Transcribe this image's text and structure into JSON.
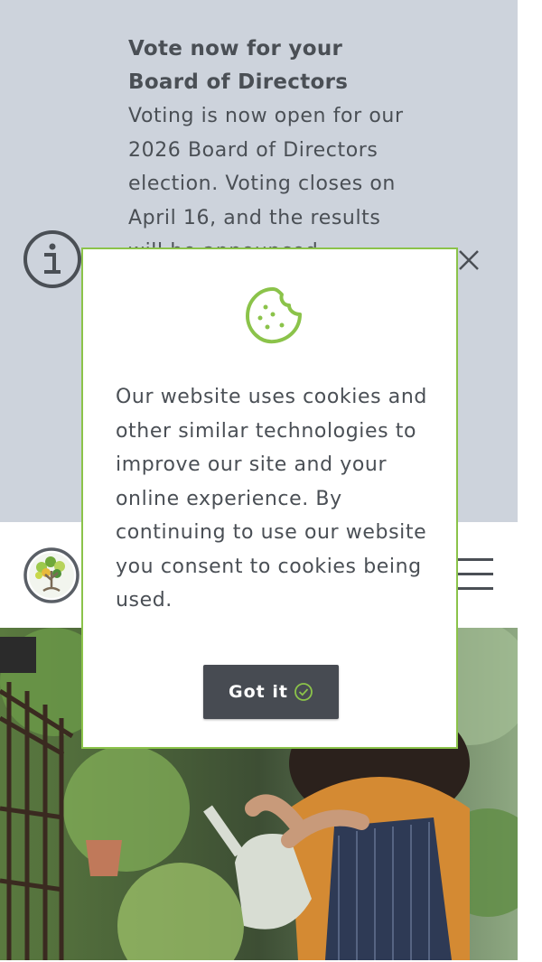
{
  "alert": {
    "title": "Vote now for your Board of Directors",
    "body": "Voting is now open for our 2026 Board of Directors election. Voting closes on April 16, and the results will be announced",
    "close_label": "×"
  },
  "cookie": {
    "message": "Our website uses cookies and other similar technologies to improve our site and your online experience. By continuing to use our website you consent to cookies being used.",
    "button_label": "Got it"
  },
  "icons": {
    "alert": "info-icon",
    "close": "close-icon",
    "cookie": "cookie-icon",
    "check": "check-circle-icon",
    "menu": "hamburger-menu-icon",
    "logo": "tree-logo"
  },
  "colors": {
    "banner_bg": "#cdd3dc",
    "accent_green": "#8bc34a",
    "text_dark": "#4a4f55",
    "button_bg": "#474b52"
  }
}
